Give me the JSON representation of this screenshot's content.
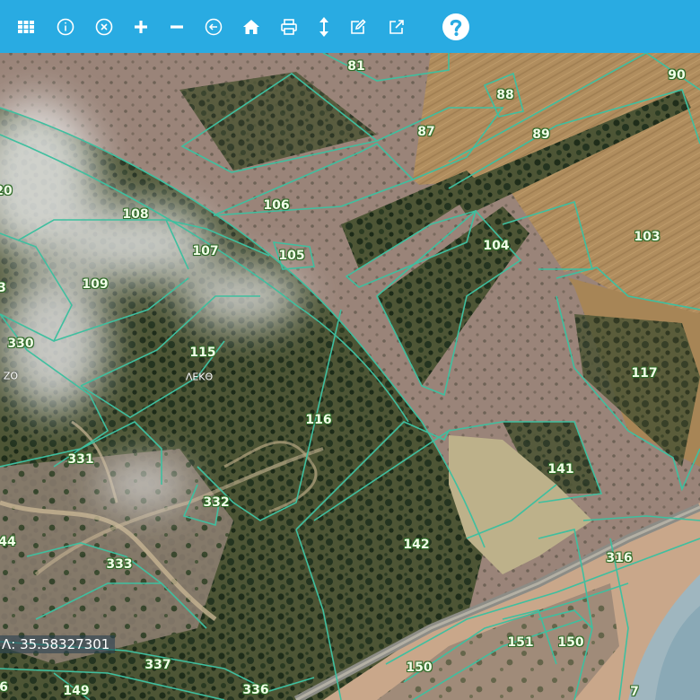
{
  "toolbar": {
    "background": "#29abe2",
    "buttons": [
      {
        "name": "grid-menu",
        "icon": "grid-icon"
      },
      {
        "name": "info",
        "icon": "info-icon"
      },
      {
        "name": "clear",
        "icon": "circle-x-icon"
      },
      {
        "name": "zoom-in",
        "icon": "plus-icon"
      },
      {
        "name": "zoom-out",
        "icon": "minus-icon"
      },
      {
        "name": "back",
        "icon": "circle-arrow-left-icon"
      },
      {
        "name": "home",
        "icon": "home-icon"
      },
      {
        "name": "print",
        "icon": "printer-icon"
      },
      {
        "name": "measure",
        "icon": "vertical-arrows-icon"
      },
      {
        "name": "edit",
        "icon": "edit-icon"
      },
      {
        "name": "open-external",
        "icon": "external-link-icon"
      },
      {
        "name": "help",
        "icon": "question-circle-icon"
      }
    ]
  },
  "map": {
    "parcel_line_color": "#3fbf9f",
    "parcels": [
      {
        "id": "81",
        "text": "81"
      },
      {
        "id": "88",
        "text": "88"
      },
      {
        "id": "90",
        "text": "90"
      },
      {
        "id": "87",
        "text": "87"
      },
      {
        "id": "89",
        "text": "89"
      },
      {
        "id": "20",
        "text": "20"
      },
      {
        "id": "108",
        "text": "108"
      },
      {
        "id": "106",
        "text": "106"
      },
      {
        "id": "107",
        "text": "107"
      },
      {
        "id": "105",
        "text": "105"
      },
      {
        "id": "104",
        "text": "104"
      },
      {
        "id": "103",
        "text": "103"
      },
      {
        "id": "109",
        "text": "109"
      },
      {
        "id": "3",
        "text": "3"
      },
      {
        "id": "330",
        "text": "330"
      },
      {
        "id": "115",
        "text": "115"
      },
      {
        "id": "117",
        "text": "117"
      },
      {
        "id": "116",
        "text": "116"
      },
      {
        "id": "331",
        "text": "331"
      },
      {
        "id": "141",
        "text": "141"
      },
      {
        "id": "332",
        "text": "332"
      },
      {
        "id": "44",
        "text": "44"
      },
      {
        "id": "142",
        "text": "142"
      },
      {
        "id": "333",
        "text": "333"
      },
      {
        "id": "316",
        "text": "316"
      },
      {
        "id": "151",
        "text": "151"
      },
      {
        "id": "150a",
        "text": "150"
      },
      {
        "id": "337",
        "text": "337"
      },
      {
        "id": "150b",
        "text": "150"
      },
      {
        "id": "149",
        "text": "149"
      },
      {
        "id": "336",
        "text": "336"
      },
      {
        "id": "6",
        "text": "6"
      },
      {
        "id": "7",
        "text": "7"
      }
    ],
    "place_labels": {
      "lekg": "ΛΕΚΘ",
      "zo": "ΖΟ"
    },
    "coordinate_readout": "Λ: 35.58327301"
  }
}
